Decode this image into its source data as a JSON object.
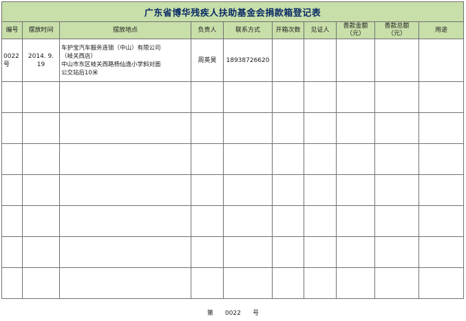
{
  "title": "广东省博华残疾人扶助基金会捐款箱登记表",
  "headers": {
    "number": "编号",
    "time": "摆放时间",
    "location": "摆放地点",
    "owner": "负责人",
    "contact": "联系方式",
    "open_count": "开箱次数",
    "witness": "见证人",
    "amount_line1": "善款金额",
    "amount_line2": "（元）",
    "total_line1": "善款总额",
    "total_line2": "（元）",
    "usage": "用途"
  },
  "rows": [
    {
      "number_line1": "0022",
      "number_line2": "号",
      "time": "2014. 9. 19",
      "location_lines": [
        "车护宝汽车服务连锁（中山）有限公司",
        "（岐关西店）",
        "中山市东区岐关西路杨仙逸小学斜对面",
        "公交站后10米"
      ],
      "owner": "周英昊",
      "contact": "18938726620",
      "open_count": "",
      "witness": "",
      "amount": "",
      "total": "",
      "usage": ""
    }
  ],
  "blank_row_count": 7,
  "footer": {
    "prefix": "第",
    "number": "0022",
    "suffix": "号"
  },
  "colors": {
    "header_bg": "#c8dfa9",
    "title_text": "#0a2a66",
    "grid_line": "#6f6f6f"
  }
}
